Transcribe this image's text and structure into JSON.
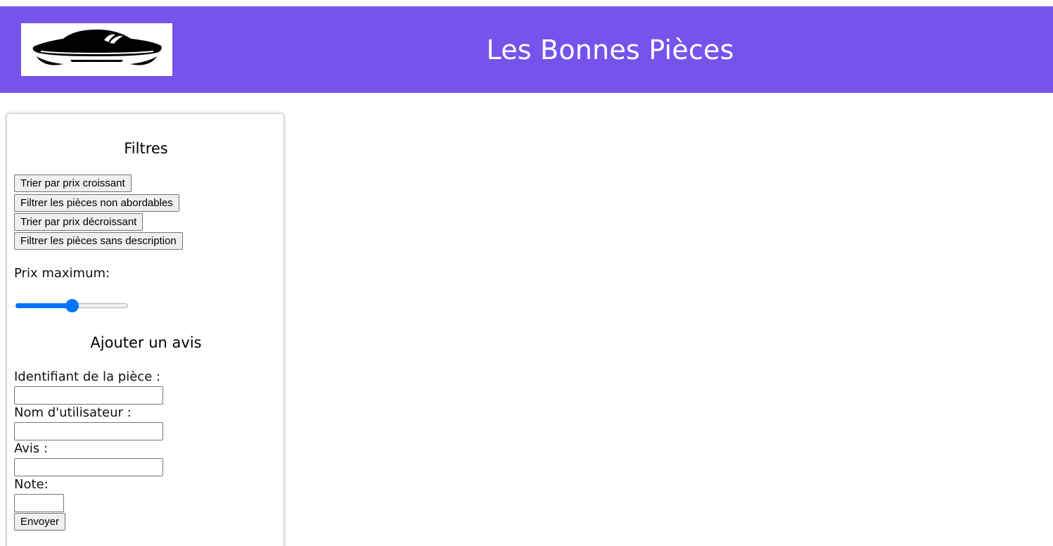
{
  "header": {
    "title": "Les Bonnes Pièces",
    "background_color": "#7654eb",
    "logo_icon": "car-silhouette-icon"
  },
  "filters": {
    "heading": "Filtres",
    "buttons": [
      "Trier par prix croissant",
      "Filtrer les pièces non abordables",
      "Trier par prix décroissant",
      "Filtrer les pièces sans description"
    ],
    "max_price_label": "Prix maximum:",
    "max_price_slider_fraction": 0.5,
    "accent_color": "#0075ff"
  },
  "review_form": {
    "heading": "Ajouter un avis",
    "piece_id_label": "Identifiant de la pièce :",
    "piece_id_value": "",
    "username_label": "Nom d'utilisateur :",
    "username_value": "",
    "review_label": "Avis :",
    "review_value": "",
    "rating_label": "Note:",
    "rating_value": "",
    "submit_label": "Envoyer"
  }
}
